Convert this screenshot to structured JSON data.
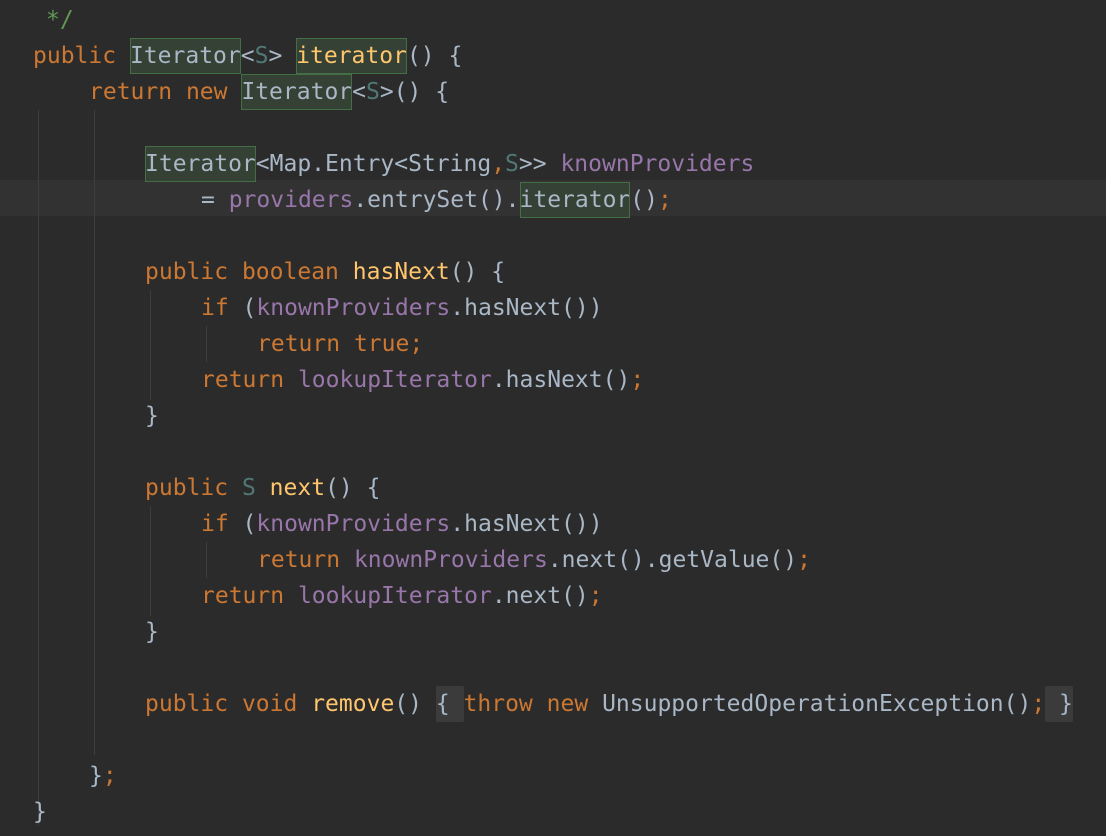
{
  "editor": {
    "theme_colors": {
      "background": "#2b2b2b",
      "current_line": "#323232",
      "keyword": "#cc7832",
      "method_declaration": "#ffc66d",
      "field": "#9876aa",
      "type_parameter": "#507874",
      "comment": "#629755",
      "plain": "#a9b7c6",
      "usage_highlight": "#344134"
    },
    "lines": [
      {
        "tokens": [
          {
            "t": "*/",
            "k": "cm"
          }
        ]
      },
      {
        "tokens": [
          {
            "t": "public",
            "k": "kw"
          },
          {
            "t": " ",
            "k": "pl"
          },
          {
            "t": "Iterator",
            "k": "typ",
            "hl": true
          },
          {
            "t": "<",
            "k": "pl"
          },
          {
            "t": "S",
            "k": "tp"
          },
          {
            "t": "> ",
            "k": "pl"
          },
          {
            "t": "iterator",
            "k": "fn",
            "hl": true
          },
          {
            "t": "() {",
            "k": "pl"
          }
        ]
      },
      {
        "tokens": [
          {
            "t": "return",
            "k": "kw"
          },
          {
            "t": " ",
            "k": "pl"
          },
          {
            "t": "new",
            "k": "kw"
          },
          {
            "t": " ",
            "k": "pl"
          },
          {
            "t": "Iterator",
            "k": "typ",
            "hl": true
          },
          {
            "t": "<",
            "k": "pl"
          },
          {
            "t": "S",
            "k": "tp"
          },
          {
            "t": ">() {",
            "k": "pl"
          }
        ]
      },
      {
        "tokens": []
      },
      {
        "tokens": [
          {
            "t": "Iterator",
            "k": "typ",
            "hl": true
          },
          {
            "t": "<Map.Entry<String",
            "k": "pl"
          },
          {
            "t": ",",
            "k": "kw"
          },
          {
            "t": "S",
            "k": "tp"
          },
          {
            "t": ">> ",
            "k": "pl"
          },
          {
            "t": "knownProviders",
            "k": "fld"
          }
        ]
      },
      {
        "tokens": [
          {
            "t": "= ",
            "k": "pl"
          },
          {
            "t": "providers",
            "k": "fld"
          },
          {
            "t": ".entrySet().",
            "k": "pl"
          },
          {
            "t": "iterator",
            "k": "typ",
            "hl": true
          },
          {
            "t": "()",
            "k": "pl"
          },
          {
            "t": ";",
            "k": "kw"
          }
        ]
      },
      {
        "tokens": []
      },
      {
        "tokens": [
          {
            "t": "public",
            "k": "kw"
          },
          {
            "t": " ",
            "k": "pl"
          },
          {
            "t": "boolean",
            "k": "kw"
          },
          {
            "t": " ",
            "k": "pl"
          },
          {
            "t": "hasNext",
            "k": "fn"
          },
          {
            "t": "() {",
            "k": "pl"
          }
        ]
      },
      {
        "tokens": [
          {
            "t": "if",
            "k": "kw"
          },
          {
            "t": " (",
            "k": "pl"
          },
          {
            "t": "knownProviders",
            "k": "fld"
          },
          {
            "t": ".hasNext())",
            "k": "pl"
          }
        ]
      },
      {
        "tokens": [
          {
            "t": "return",
            "k": "kw"
          },
          {
            "t": " ",
            "k": "pl"
          },
          {
            "t": "true",
            "k": "kw"
          },
          {
            "t": ";",
            "k": "kw"
          }
        ]
      },
      {
        "tokens": [
          {
            "t": "return",
            "k": "kw"
          },
          {
            "t": " ",
            "k": "pl"
          },
          {
            "t": "lookupIterator",
            "k": "fld"
          },
          {
            "t": ".hasNext()",
            "k": "pl"
          },
          {
            "t": ";",
            "k": "kw"
          }
        ]
      },
      {
        "tokens": [
          {
            "t": "}",
            "k": "pl"
          }
        ]
      },
      {
        "tokens": []
      },
      {
        "tokens": [
          {
            "t": "public",
            "k": "kw"
          },
          {
            "t": " ",
            "k": "pl"
          },
          {
            "t": "S",
            "k": "tp"
          },
          {
            "t": " ",
            "k": "pl"
          },
          {
            "t": "next",
            "k": "fn"
          },
          {
            "t": "() {",
            "k": "pl"
          }
        ]
      },
      {
        "tokens": [
          {
            "t": "if",
            "k": "kw"
          },
          {
            "t": " (",
            "k": "pl"
          },
          {
            "t": "knownProviders",
            "k": "fld"
          },
          {
            "t": ".hasNext())",
            "k": "pl"
          }
        ]
      },
      {
        "tokens": [
          {
            "t": "return",
            "k": "kw"
          },
          {
            "t": " ",
            "k": "pl"
          },
          {
            "t": "knownProviders",
            "k": "fld"
          },
          {
            "t": ".next().getValue()",
            "k": "pl"
          },
          {
            "t": ";",
            "k": "kw"
          }
        ]
      },
      {
        "tokens": [
          {
            "t": "return",
            "k": "kw"
          },
          {
            "t": " ",
            "k": "pl"
          },
          {
            "t": "lookupIterator",
            "k": "fld"
          },
          {
            "t": ".next()",
            "k": "pl"
          },
          {
            "t": ";",
            "k": "kw"
          }
        ]
      },
      {
        "tokens": [
          {
            "t": "}",
            "k": "pl"
          }
        ]
      },
      {
        "tokens": []
      },
      {
        "tokens": [
          {
            "t": "public",
            "k": "kw"
          },
          {
            "t": " ",
            "k": "pl"
          },
          {
            "t": "void",
            "k": "kw"
          },
          {
            "t": " ",
            "k": "pl"
          },
          {
            "t": "remove",
            "k": "fn"
          },
          {
            "t": "() ",
            "k": "pl"
          },
          {
            "t": "{ ",
            "k": "pl",
            "bm": true
          },
          {
            "t": "throw",
            "k": "kw"
          },
          {
            "t": " ",
            "k": "pl"
          },
          {
            "t": "new",
            "k": "kw"
          },
          {
            "t": " ",
            "k": "pl"
          },
          {
            "t": "UnsupportedOperationException()",
            "k": "pl"
          },
          {
            "t": ";",
            "k": "kw"
          },
          {
            "t": " }",
            "k": "pl",
            "bm": true
          }
        ]
      },
      {
        "tokens": []
      },
      {
        "tokens": [
          {
            "t": "}",
            "k": "pl"
          },
          {
            "t": ";",
            "k": "kw"
          }
        ]
      },
      {
        "tokens": [
          {
            "t": "}",
            "k": "pl"
          }
        ]
      }
    ]
  }
}
